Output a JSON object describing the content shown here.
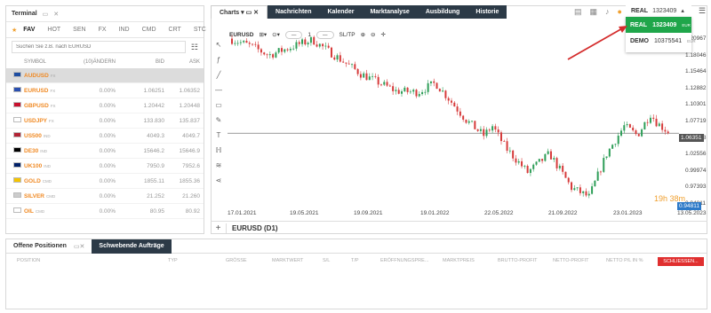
{
  "terminal": {
    "title": "Terminal",
    "tabs": [
      "FAV",
      "HOT",
      "SEN",
      "FX",
      "IND",
      "CMD",
      "CRT",
      "STC"
    ],
    "search_placeholder": "Suchen Sie z.B. nach EURUSD",
    "columns": [
      "SYMBOL",
      "(10)ÄNDERN",
      "BID",
      "ASK"
    ],
    "rows": [
      {
        "symbol": "AUDUSD",
        "type": "FX",
        "change": "",
        "bid": "",
        "ask": "",
        "selected": true
      },
      {
        "symbol": "EURUSD",
        "type": "FX",
        "change": "0.00%",
        "bid": "1.06251",
        "ask": "1.06352"
      },
      {
        "symbol": "GBPUSD",
        "type": "FX",
        "change": "0.00%",
        "bid": "1.20442",
        "ask": "1.20448"
      },
      {
        "symbol": "USDJPY",
        "type": "FX",
        "change": "0.00%",
        "bid": "133.830",
        "ask": "135.837"
      },
      {
        "symbol": "US500",
        "type": "IND",
        "change": "0.00%",
        "bid": "4049.3",
        "ask": "4049.7"
      },
      {
        "symbol": "DE30",
        "type": "IND",
        "change": "0.00%",
        "bid": "15646.2",
        "ask": "15646.9"
      },
      {
        "symbol": "UK100",
        "type": "IND",
        "change": "0.00%",
        "bid": "7950.9",
        "ask": "7952.6"
      },
      {
        "symbol": "GOLD",
        "type": "CMD",
        "change": "0.00%",
        "bid": "1855.11",
        "ask": "1855.36"
      },
      {
        "symbol": "SILVER",
        "type": "CMD",
        "change": "0.00%",
        "bid": "21.252",
        "ask": "21.260"
      },
      {
        "symbol": "OIL",
        "type": "CMD",
        "change": "0.00%",
        "bid": "80.95",
        "ask": "80.92"
      }
    ]
  },
  "nav": {
    "charts": "Charts",
    "tabs": [
      "Nachrichten",
      "Kalender",
      "Marktanalyse",
      "Ausbildung",
      "Historie"
    ]
  },
  "chart": {
    "symbol": "EURUSD",
    "timeframe": "D1",
    "toolbar_qty": "1",
    "toolbar_sltp": "SL/TP",
    "footer_title": "EURUSD (D1)",
    "y_labels": [
      "1.20967",
      "1.18046",
      "1.15464",
      "1.12882",
      "1.10301",
      "1.07719",
      "1.05138",
      "1.02556",
      "0.99974",
      "0.97393",
      "0.94811"
    ],
    "x_labels": [
      "17.01.2021",
      "19.05.2021",
      "19.09.2021",
      "19.01.2022",
      "22.05.2022",
      "21.09.2022",
      "23.01.2023",
      "13.05.2023"
    ],
    "price_tag": "1.06351",
    "countdown": "19h 38m",
    "count_tag": "0.94811",
    "colors": {
      "up": "#2e9e58",
      "down": "#d63a3a",
      "line": "#7a7a7a"
    }
  },
  "account": {
    "type": "REAL",
    "number": "1323409",
    "options": [
      {
        "type": "REAL",
        "number": "1323409",
        "currency": "EUR"
      },
      {
        "type": "DEMO",
        "number": "10375541",
        "currency": "EUR"
      }
    ]
  },
  "bottom": {
    "tab_open": "Offene Positionen",
    "tab_pending": "Schwebende Aufträge",
    "columns": [
      "POSITION",
      "TYP",
      "GRÖSSE",
      "MARKTWERT",
      "S/L",
      "T/P",
      "ERÖFFNUNGSPRE...",
      "MARKTPREIS",
      "BRUTTO-PROFIT",
      "NETTO-PROFIT",
      "NETTO P/L IN %",
      "ROLLOVER"
    ],
    "close_all": "SCHLIESSEN..."
  }
}
